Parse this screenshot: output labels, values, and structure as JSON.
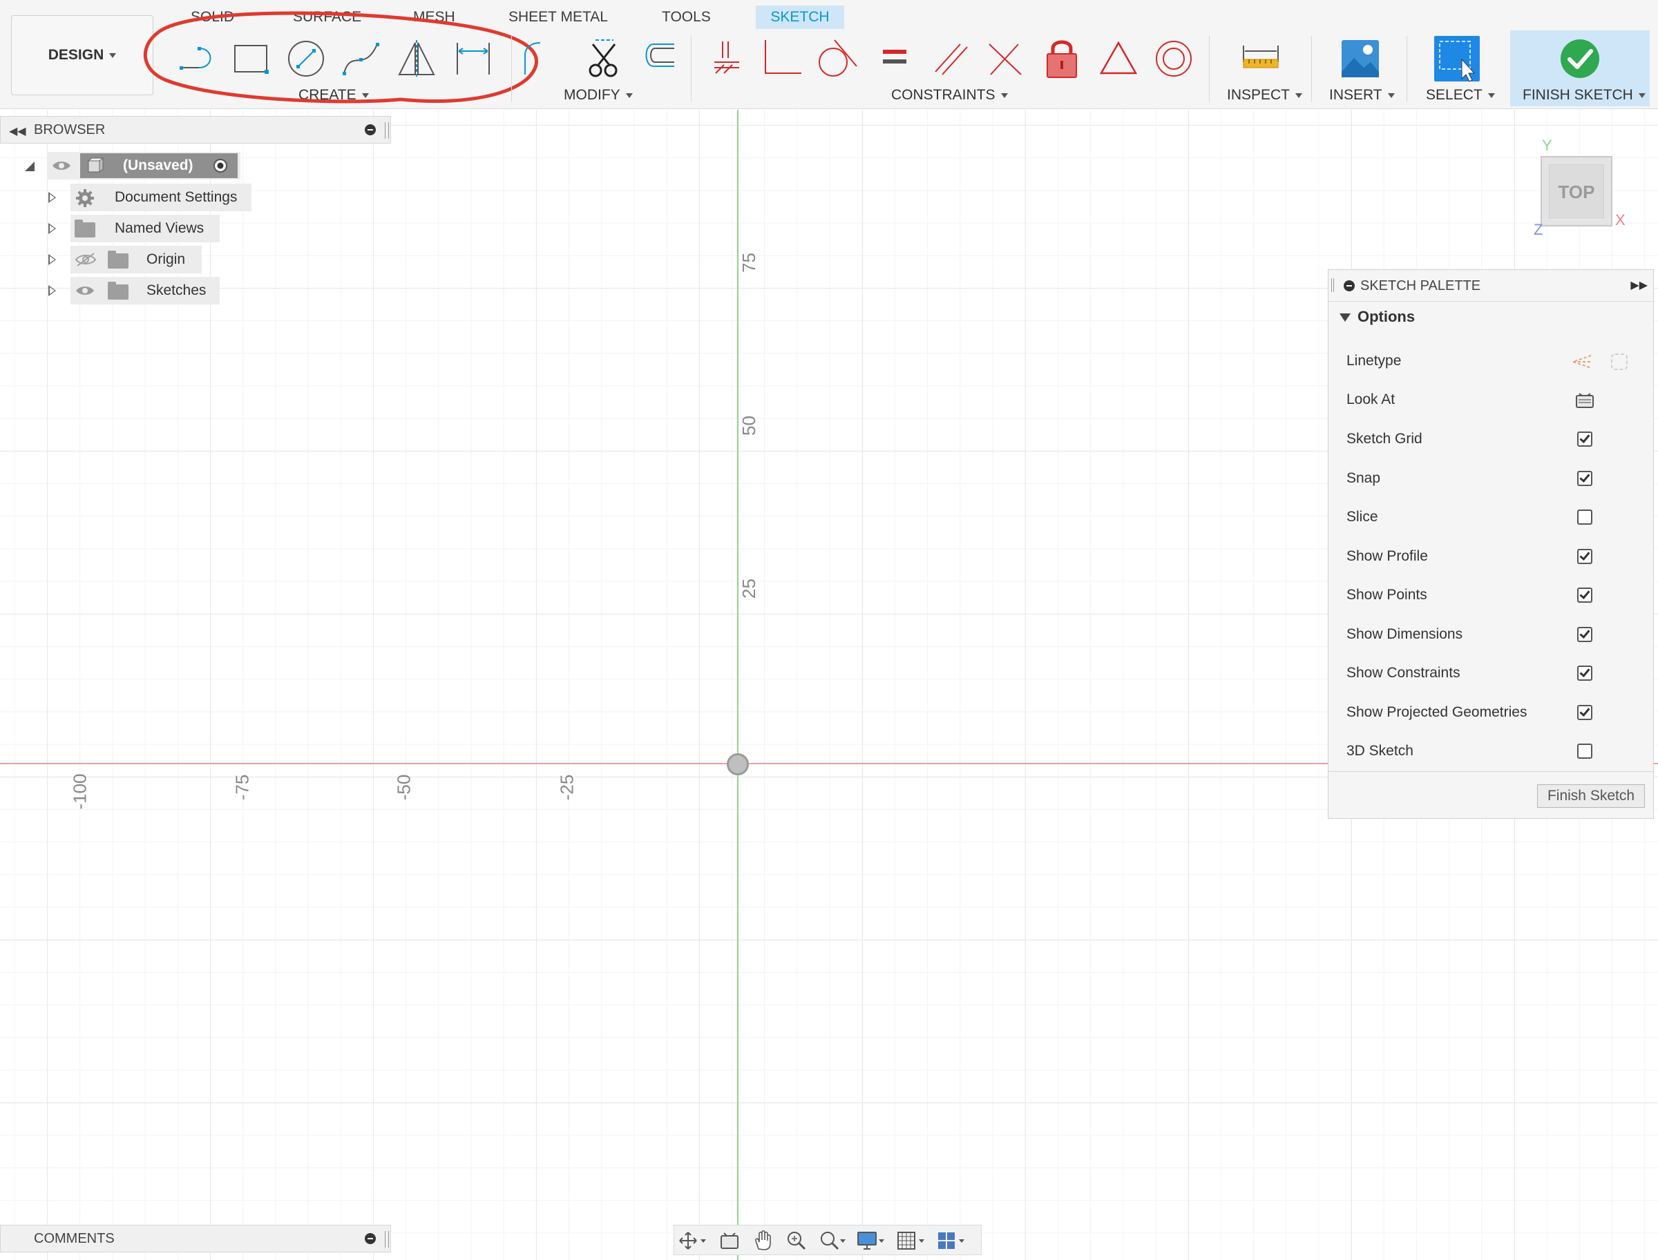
{
  "workspace_button": {
    "label": "DESIGN"
  },
  "tabs": [
    {
      "label": "SOLID",
      "active": false
    },
    {
      "label": "SURFACE",
      "active": false
    },
    {
      "label": "MESH",
      "active": false
    },
    {
      "label": "SHEET METAL",
      "active": false
    },
    {
      "label": "TOOLS",
      "active": false
    },
    {
      "label": "SKETCH",
      "active": true
    }
  ],
  "toolbar_groups": {
    "create": "CREATE",
    "modify": "MODIFY",
    "constraints": "CONSTRAINTS",
    "inspect": "INSPECT",
    "insert": "INSERT",
    "select": "SELECT",
    "finish_sketch": "FINISH SKETCH"
  },
  "tool_icons": {
    "create": [
      "line-icon",
      "rectangle-icon",
      "circle-icon",
      "spline-icon",
      "mirror-icon",
      "dimension-icon"
    ],
    "modify": [
      "fillet-icon",
      "trim-icon",
      "offset-icon"
    ],
    "constraints": [
      "coincident-icon",
      "horizontal-vertical-icon",
      "tangent-icon",
      "equal-icon",
      "parallel-icon",
      "perpendicular-icon",
      "fix-icon",
      "midpoint-icon",
      "concentric-icon"
    ],
    "inspect": [
      "measure-icon"
    ],
    "insert": [
      "insert-image-icon"
    ],
    "select": [
      "select-icon"
    ],
    "finish": [
      "finish-check-icon"
    ]
  },
  "browser": {
    "title": "BROWSER",
    "root": "(Unsaved)",
    "items": [
      {
        "label": "Document Settings",
        "icon": "gear-icon"
      },
      {
        "label": "Named Views",
        "icon": "folder-icon"
      },
      {
        "label": "Origin",
        "icon": "folder-icon",
        "visibility": "hidden"
      },
      {
        "label": "Sketches",
        "icon": "folder-icon",
        "visibility": "visible"
      }
    ]
  },
  "canvas": {
    "axis_labels_y": [
      "75",
      "50",
      "25"
    ],
    "axis_labels_x": [
      "-100",
      "-75",
      "-50",
      "-25"
    ]
  },
  "view_cube": {
    "face": "TOP",
    "x": "X",
    "y": "Y",
    "z": "Z"
  },
  "sketch_palette": {
    "title": "SKETCH PALETTE",
    "section": "Options",
    "options": [
      {
        "label": "Linetype",
        "type": "icons"
      },
      {
        "label": "Look At",
        "type": "button"
      },
      {
        "label": "Sketch Grid",
        "checked": true
      },
      {
        "label": "Snap",
        "checked": true
      },
      {
        "label": "Slice",
        "checked": false
      },
      {
        "label": "Show Profile",
        "checked": true
      },
      {
        "label": "Show Points",
        "checked": true
      },
      {
        "label": "Show Dimensions",
        "checked": true
      },
      {
        "label": "Show Constraints",
        "checked": true
      },
      {
        "label": "Show Projected Geometries",
        "checked": true
      },
      {
        "label": "3D Sketch",
        "checked": false
      }
    ],
    "finish_button": "Finish Sketch"
  },
  "comments": {
    "title": "COMMENTS"
  },
  "colors": {
    "accent": "#0696d7",
    "constraint_red": "#d62728",
    "annotation_red": "#e03a2f",
    "finish_green": "#2fa84f",
    "y_axis": "#8fd48f",
    "x_axis": "#f0a0a0"
  }
}
